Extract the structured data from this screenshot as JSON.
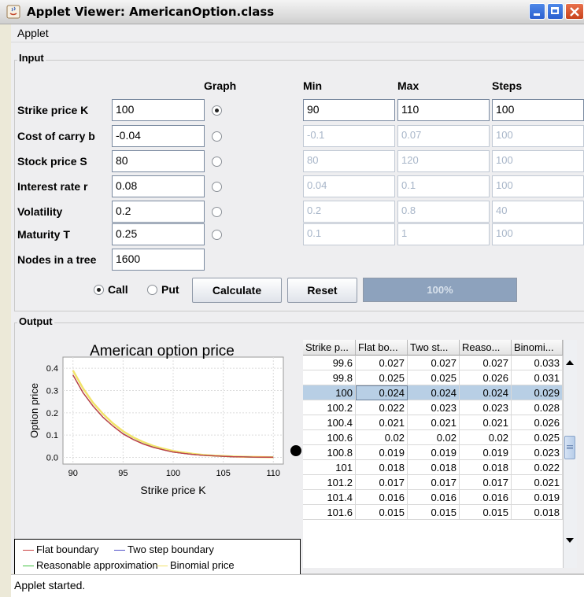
{
  "window": {
    "title": "Applet Viewer: AmericanOption.class"
  },
  "menu": {
    "applet": "Applet"
  },
  "input": {
    "group_title": "Input",
    "headers": {
      "graph": "Graph",
      "min": "Min",
      "max": "Max",
      "steps": "Steps"
    },
    "params": [
      {
        "label": "Strike price K",
        "value": "100",
        "graph_selected": true,
        "min": "90",
        "max": "110",
        "steps": "100",
        "range_enabled": true
      },
      {
        "label": "Cost of carry  b",
        "value": "-0.04",
        "graph_selected": false,
        "min": "-0.1",
        "max": "0.07",
        "steps": "100",
        "range_enabled": false
      },
      {
        "label": "Stock price  S",
        "value": "80",
        "graph_selected": false,
        "min": "80",
        "max": "120",
        "steps": "100",
        "range_enabled": false
      },
      {
        "label": "Interest rate  r",
        "value": "0.08",
        "graph_selected": false,
        "min": "0.04",
        "max": "0.1",
        "steps": "100",
        "range_enabled": false
      },
      {
        "label": "Volatility",
        "value": "0.2",
        "graph_selected": false,
        "min": "0.2",
        "max": "0.8",
        "steps": "40",
        "range_enabled": false
      },
      {
        "label": "Maturity  T",
        "value": "0.25",
        "graph_selected": false,
        "min": "0.1",
        "max": "1",
        "steps": "100",
        "range_enabled": false
      }
    ],
    "nodes": {
      "label": "Nodes in a tree",
      "value": "1600"
    },
    "option_type": {
      "call_label": "Call",
      "put_label": "Put",
      "selected": "Call"
    },
    "calculate_label": "Calculate",
    "reset_label": "Reset",
    "progress": {
      "text": "100%",
      "value": 1.0
    }
  },
  "output": {
    "group_title": "Output",
    "table": {
      "columns": [
        "Strike p...",
        "Flat bo...",
        "Two st...",
        "Reaso...",
        "Binomi..."
      ],
      "rows": [
        [
          "99.6",
          "0.027",
          "0.027",
          "0.027",
          "0.033"
        ],
        [
          "99.8",
          "0.025",
          "0.025",
          "0.026",
          "0.031"
        ],
        [
          "100",
          "0.024",
          "0.024",
          "0.024",
          "0.029"
        ],
        [
          "100.2",
          "0.022",
          "0.023",
          "0.023",
          "0.028"
        ],
        [
          "100.4",
          "0.021",
          "0.021",
          "0.021",
          "0.026"
        ],
        [
          "100.6",
          "0.02",
          "0.02",
          "0.02",
          "0.025"
        ],
        [
          "100.8",
          "0.019",
          "0.019",
          "0.019",
          "0.023"
        ],
        [
          "101",
          "0.018",
          "0.018",
          "0.018",
          "0.022"
        ],
        [
          "101.2",
          "0.017",
          "0.017",
          "0.017",
          "0.021"
        ],
        [
          "101.4",
          "0.016",
          "0.016",
          "0.016",
          "0.019"
        ],
        [
          "101.6",
          "0.015",
          "0.015",
          "0.015",
          "0.018"
        ]
      ],
      "selected_row": 2
    }
  },
  "chart_data": {
    "type": "line",
    "title": "American option price",
    "xlabel": "Strike price K",
    "ylabel": "Option price",
    "xlim": [
      89,
      111
    ],
    "ylim": [
      -0.03,
      0.45
    ],
    "xticks": [
      "90",
      "95",
      "100",
      "105",
      "110"
    ],
    "yticks": [
      "0.4",
      "0.3",
      "0.2",
      "0.1",
      "0.0"
    ],
    "x": [
      90,
      91,
      92,
      93,
      94,
      95,
      96,
      97,
      98,
      99,
      100,
      101,
      102,
      103,
      104,
      105,
      106,
      107,
      108,
      109,
      110
    ],
    "series": [
      {
        "name": "Flat boundary",
        "color": "#c94040",
        "values": [
          0.37,
          0.29,
          0.23,
          0.18,
          0.14,
          0.105,
          0.08,
          0.06,
          0.045,
          0.034,
          0.024,
          0.018,
          0.013,
          0.009,
          0.007,
          0.005,
          0.003,
          0.002,
          0.0015,
          0.001,
          0.0005
        ]
      },
      {
        "name": "Two step boundary",
        "color": "#5050c8",
        "values": [
          0.37,
          0.29,
          0.23,
          0.18,
          0.14,
          0.106,
          0.081,
          0.061,
          0.046,
          0.034,
          0.024,
          0.018,
          0.013,
          0.009,
          0.007,
          0.005,
          0.003,
          0.002,
          0.0015,
          0.001,
          0.0005
        ]
      },
      {
        "name": "Reasonable approximation",
        "color": "#40c040",
        "values": [
          0.37,
          0.29,
          0.23,
          0.18,
          0.14,
          0.106,
          0.081,
          0.061,
          0.046,
          0.034,
          0.024,
          0.018,
          0.013,
          0.009,
          0.007,
          0.005,
          0.003,
          0.002,
          0.0015,
          0.001,
          0.0005
        ]
      },
      {
        "name": "Binomial price",
        "color": "#f2e36a",
        "values": [
          0.39,
          0.31,
          0.245,
          0.195,
          0.152,
          0.117,
          0.09,
          0.069,
          0.052,
          0.039,
          0.029,
          0.022,
          0.016,
          0.011,
          0.008,
          0.006,
          0.004,
          0.003,
          0.002,
          0.0015,
          0.001
        ]
      }
    ],
    "grid": true,
    "legend": "bottom"
  },
  "status": {
    "text": "Applet started."
  },
  "colors": {
    "progress_fill": "#8da2bd",
    "selection": "#b8cfe5"
  }
}
